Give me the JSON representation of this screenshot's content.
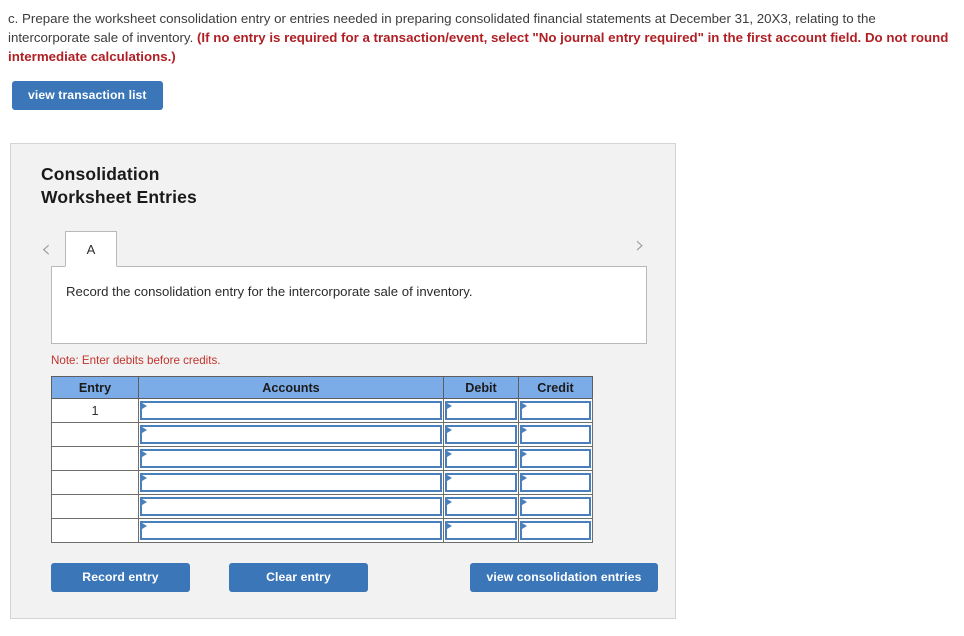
{
  "instructions": {
    "part_label": "c.",
    "text_plain": "c. Prepare the worksheet consolidation entry or entries needed in preparing consolidated financial statements at December 31, 20X3, relating to the intercorporate sale of inventory. ",
    "text_red": "(If no entry is required for a transaction/event, select \"No journal entry required\" in the first account field. Do not round intermediate calculations.)"
  },
  "toolbar": {
    "view_transaction_list_label": "view transaction list"
  },
  "panel": {
    "title_line1": "Consolidation",
    "title_line2": "Worksheet Entries",
    "prev_icon": "chevron-left-icon",
    "next_icon": "chevron-right-icon",
    "tabs": [
      {
        "label": "A",
        "active": true
      }
    ],
    "tab_content_text": "Record the consolidation entry for the intercorporate sale of inventory.",
    "note": "Note: Enter debits before credits."
  },
  "journal_table": {
    "columns": [
      "Entry",
      "Accounts",
      "Debit",
      "Credit"
    ],
    "rows": [
      {
        "entry": "1",
        "account": "",
        "debit": "",
        "credit": ""
      },
      {
        "entry": "",
        "account": "",
        "debit": "",
        "credit": ""
      },
      {
        "entry": "",
        "account": "",
        "debit": "",
        "credit": ""
      },
      {
        "entry": "",
        "account": "",
        "debit": "",
        "credit": ""
      },
      {
        "entry": "",
        "account": "",
        "debit": "",
        "credit": ""
      },
      {
        "entry": "",
        "account": "",
        "debit": "",
        "credit": ""
      }
    ]
  },
  "actions": {
    "record_entry_label": "Record entry",
    "clear_entry_label": "Clear entry",
    "view_consolidation_entries_label": "view consolidation entries"
  },
  "colors": {
    "button_blue": "#3a76b8",
    "table_header_blue": "#7bace8",
    "input_border_blue": "#4a7fbd",
    "panel_background": "#f2f2f2",
    "red_text": "#b01f24",
    "note_red": "#c0342c"
  }
}
